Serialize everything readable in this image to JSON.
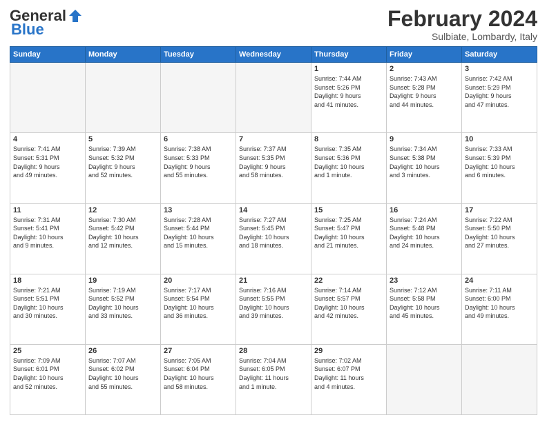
{
  "header": {
    "logo_general": "General",
    "logo_blue": "Blue",
    "month_title": "February 2024",
    "location": "Sulbiate, Lombardy, Italy"
  },
  "days_of_week": [
    "Sunday",
    "Monday",
    "Tuesday",
    "Wednesday",
    "Thursday",
    "Friday",
    "Saturday"
  ],
  "weeks": [
    [
      {
        "day": "",
        "info": ""
      },
      {
        "day": "",
        "info": ""
      },
      {
        "day": "",
        "info": ""
      },
      {
        "day": "",
        "info": ""
      },
      {
        "day": "1",
        "info": "Sunrise: 7:44 AM\nSunset: 5:26 PM\nDaylight: 9 hours\nand 41 minutes."
      },
      {
        "day": "2",
        "info": "Sunrise: 7:43 AM\nSunset: 5:28 PM\nDaylight: 9 hours\nand 44 minutes."
      },
      {
        "day": "3",
        "info": "Sunrise: 7:42 AM\nSunset: 5:29 PM\nDaylight: 9 hours\nand 47 minutes."
      }
    ],
    [
      {
        "day": "4",
        "info": "Sunrise: 7:41 AM\nSunset: 5:31 PM\nDaylight: 9 hours\nand 49 minutes."
      },
      {
        "day": "5",
        "info": "Sunrise: 7:39 AM\nSunset: 5:32 PM\nDaylight: 9 hours\nand 52 minutes."
      },
      {
        "day": "6",
        "info": "Sunrise: 7:38 AM\nSunset: 5:33 PM\nDaylight: 9 hours\nand 55 minutes."
      },
      {
        "day": "7",
        "info": "Sunrise: 7:37 AM\nSunset: 5:35 PM\nDaylight: 9 hours\nand 58 minutes."
      },
      {
        "day": "8",
        "info": "Sunrise: 7:35 AM\nSunset: 5:36 PM\nDaylight: 10 hours\nand 1 minute."
      },
      {
        "day": "9",
        "info": "Sunrise: 7:34 AM\nSunset: 5:38 PM\nDaylight: 10 hours\nand 3 minutes."
      },
      {
        "day": "10",
        "info": "Sunrise: 7:33 AM\nSunset: 5:39 PM\nDaylight: 10 hours\nand 6 minutes."
      }
    ],
    [
      {
        "day": "11",
        "info": "Sunrise: 7:31 AM\nSunset: 5:41 PM\nDaylight: 10 hours\nand 9 minutes."
      },
      {
        "day": "12",
        "info": "Sunrise: 7:30 AM\nSunset: 5:42 PM\nDaylight: 10 hours\nand 12 minutes."
      },
      {
        "day": "13",
        "info": "Sunrise: 7:28 AM\nSunset: 5:44 PM\nDaylight: 10 hours\nand 15 minutes."
      },
      {
        "day": "14",
        "info": "Sunrise: 7:27 AM\nSunset: 5:45 PM\nDaylight: 10 hours\nand 18 minutes."
      },
      {
        "day": "15",
        "info": "Sunrise: 7:25 AM\nSunset: 5:47 PM\nDaylight: 10 hours\nand 21 minutes."
      },
      {
        "day": "16",
        "info": "Sunrise: 7:24 AM\nSunset: 5:48 PM\nDaylight: 10 hours\nand 24 minutes."
      },
      {
        "day": "17",
        "info": "Sunrise: 7:22 AM\nSunset: 5:50 PM\nDaylight: 10 hours\nand 27 minutes."
      }
    ],
    [
      {
        "day": "18",
        "info": "Sunrise: 7:21 AM\nSunset: 5:51 PM\nDaylight: 10 hours\nand 30 minutes."
      },
      {
        "day": "19",
        "info": "Sunrise: 7:19 AM\nSunset: 5:52 PM\nDaylight: 10 hours\nand 33 minutes."
      },
      {
        "day": "20",
        "info": "Sunrise: 7:17 AM\nSunset: 5:54 PM\nDaylight: 10 hours\nand 36 minutes."
      },
      {
        "day": "21",
        "info": "Sunrise: 7:16 AM\nSunset: 5:55 PM\nDaylight: 10 hours\nand 39 minutes."
      },
      {
        "day": "22",
        "info": "Sunrise: 7:14 AM\nSunset: 5:57 PM\nDaylight: 10 hours\nand 42 minutes."
      },
      {
        "day": "23",
        "info": "Sunrise: 7:12 AM\nSunset: 5:58 PM\nDaylight: 10 hours\nand 45 minutes."
      },
      {
        "day": "24",
        "info": "Sunrise: 7:11 AM\nSunset: 6:00 PM\nDaylight: 10 hours\nand 49 minutes."
      }
    ],
    [
      {
        "day": "25",
        "info": "Sunrise: 7:09 AM\nSunset: 6:01 PM\nDaylight: 10 hours\nand 52 minutes."
      },
      {
        "day": "26",
        "info": "Sunrise: 7:07 AM\nSunset: 6:02 PM\nDaylight: 10 hours\nand 55 minutes."
      },
      {
        "day": "27",
        "info": "Sunrise: 7:05 AM\nSunset: 6:04 PM\nDaylight: 10 hours\nand 58 minutes."
      },
      {
        "day": "28",
        "info": "Sunrise: 7:04 AM\nSunset: 6:05 PM\nDaylight: 11 hours\nand 1 minute."
      },
      {
        "day": "29",
        "info": "Sunrise: 7:02 AM\nSunset: 6:07 PM\nDaylight: 11 hours\nand 4 minutes."
      },
      {
        "day": "",
        "info": ""
      },
      {
        "day": "",
        "info": ""
      }
    ]
  ]
}
